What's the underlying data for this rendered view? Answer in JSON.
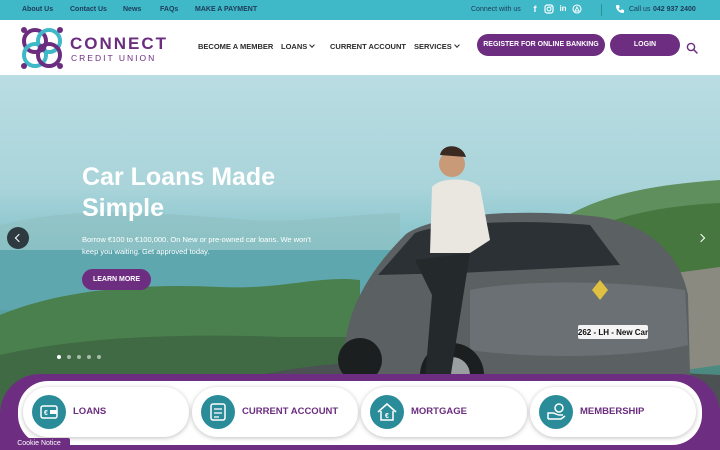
{
  "topbar": {
    "links": [
      "About Us",
      "Contact Us",
      "News",
      "FAQs",
      "MAKE A PAYMENT"
    ],
    "connect_label": "Connect with us",
    "social_icons": [
      "facebook-icon",
      "instagram-icon",
      "linkedin-icon",
      "social-icon"
    ],
    "call_label": "Call us",
    "phone": "042 937 2400"
  },
  "header": {
    "logo_title": "CONNECT",
    "logo_subtitle": "CREDIT UNION",
    "nav": [
      "BECOME A MEMBER",
      "LOANS",
      "CURRENT ACCOUNT",
      "SERVICES"
    ],
    "register_label": "REGISTER FOR ONLINE BANKING",
    "login_label": "LOGIN"
  },
  "hero": {
    "title": "Car Loans Made Simple",
    "text": "Borrow €100 to €100,000. On New or pre-owned car loans. We won't keep you waiting. Get approved today.",
    "cta_label": "LEARN MORE",
    "plate_text": "262 - LH - New Car",
    "slide_count": 5,
    "active_slide": 1
  },
  "quicklinks": [
    {
      "label": "LOANS",
      "icon": "wallet-icon"
    },
    {
      "label": "CURRENT ACCOUNT",
      "icon": "account-icon"
    },
    {
      "label": "MORTGAGE",
      "icon": "house-icon"
    },
    {
      "label": "MEMBERSHIP",
      "icon": "membership-icon"
    }
  ],
  "cookie_label": "Cookie Notice",
  "colors": {
    "topbar": "#3fb8c7",
    "brand_purple": "#6d2d80",
    "teal_icon": "#2a8b99"
  }
}
